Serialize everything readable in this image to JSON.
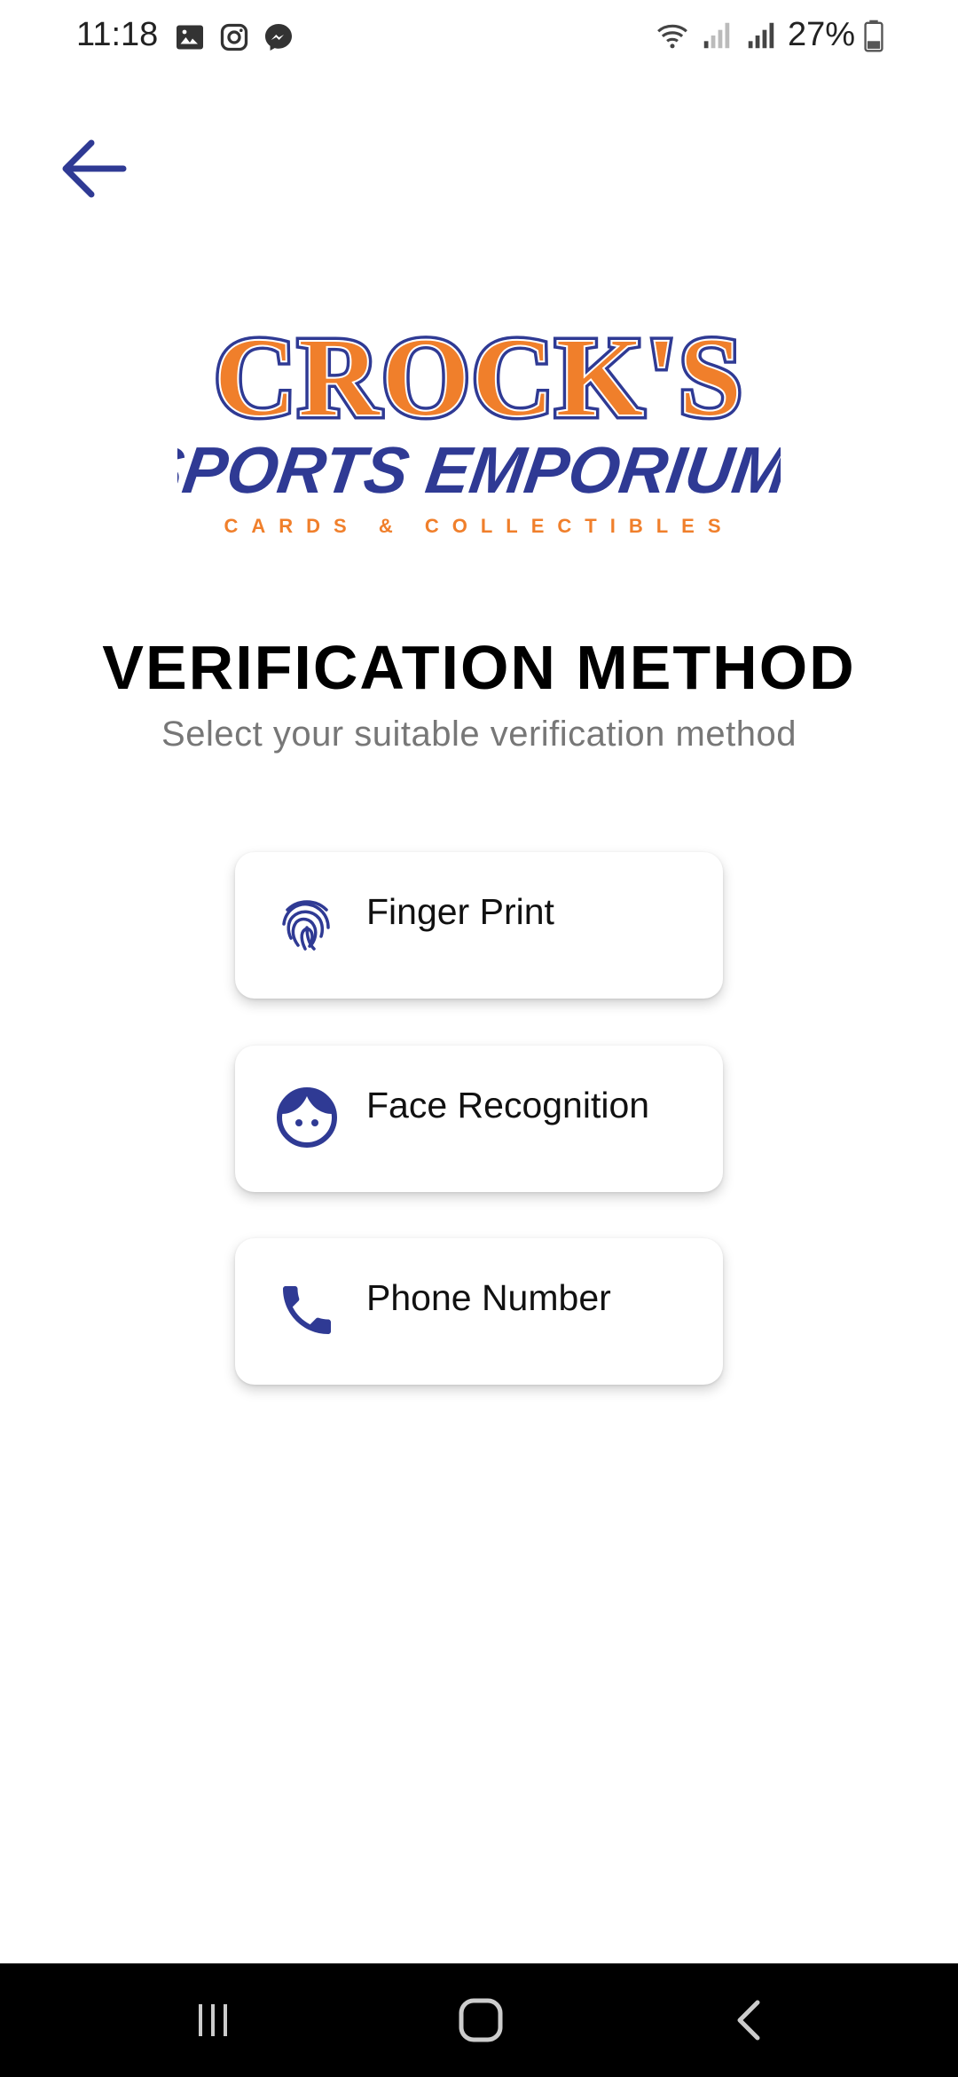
{
  "status_bar": {
    "time": "11:18",
    "battery": "27%",
    "left_icons": [
      "gallery-icon",
      "instagram-icon",
      "messenger-icon"
    ],
    "right_icons": [
      "wifi-icon",
      "signal-icon",
      "signal-icon",
      "battery-icon"
    ]
  },
  "header": {
    "back_icon": "arrow-left-icon"
  },
  "logo": {
    "line1": "CROCK'S",
    "line2": "SPORTS EMPORIUM",
    "line3": "CARDS & COLLECTIBLES"
  },
  "page": {
    "title": "VERIFICATION METHOD",
    "subtitle": "Select your suitable verification method"
  },
  "methods": [
    {
      "label": "Finger Print",
      "icon": "fingerprint-icon"
    },
    {
      "label": "Face Recognition",
      "icon": "face-icon"
    },
    {
      "label": "Phone Number",
      "icon": "phone-icon"
    }
  ],
  "nav": {
    "icons": [
      "recent-apps-icon",
      "home-icon",
      "back-nav-icon"
    ]
  },
  "colors": {
    "accent_blue": "#2F3A94",
    "accent_orange": "#F07F2B"
  }
}
